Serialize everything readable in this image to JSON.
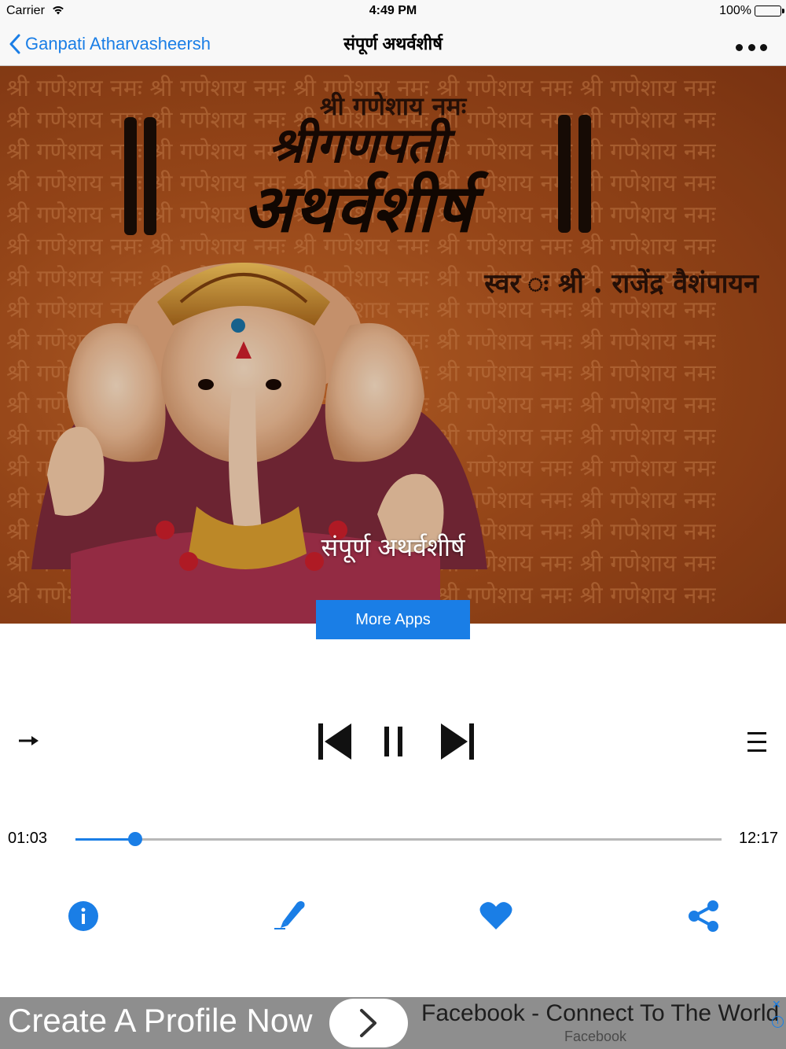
{
  "status_bar": {
    "carrier": "Carrier",
    "time": "4:49 PM",
    "battery": "100%"
  },
  "nav": {
    "back_label": "Ganpati Atharvasheersh",
    "title": "संपूर्ण अथर्वशीर्ष",
    "more_icon": "ellipsis-icon"
  },
  "artwork": {
    "pattern_text": "श्री गणेशाय नमः",
    "top_line": "श्री गणेशाय नमः",
    "title_line1": "श्रीगणपती",
    "title_line2": "अथर्वशीर्ष",
    "singer": "स्वर ः श्री . राजेंद्र वैशंपायन",
    "caption": "संपूर्ण अथर्वशीर्ष"
  },
  "more_apps_label": "More Apps",
  "player": {
    "elapsed": "01:03",
    "duration": "12:17",
    "progress": 0.092,
    "accent": "#1a7ee6"
  },
  "ad": {
    "headline": "Create A Profile Now",
    "title": "Facebook - Connect To The World",
    "subtitle": "Facebook",
    "close": "✕",
    "info": "i"
  }
}
